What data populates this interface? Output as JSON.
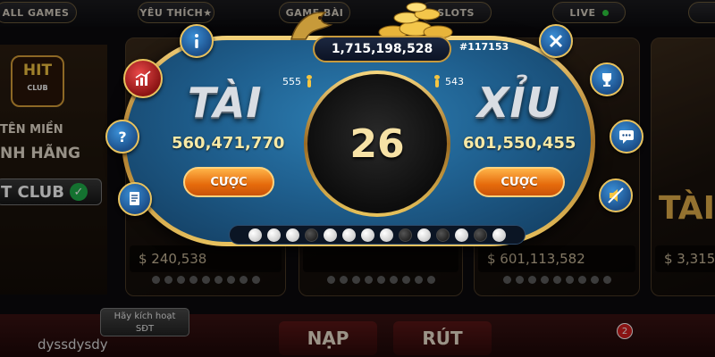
{
  "topnav": {
    "all_games": "ALL GAMES",
    "favorites": "YÊU THÍCH★",
    "card_games": "GAME BÀI",
    "slots": "SLOTS",
    "live": "LIVE"
  },
  "left_panel": {
    "logo_text": "HIT",
    "logo_sub": "CLUB",
    "promo_line1": "TÊN MIỀN",
    "promo_line2": "NH HÃNG",
    "club_label": "T CLUB"
  },
  "bg_cards": {
    "jackpots": [
      "$ 240,538",
      "",
      "$ 601,113,582",
      "$ 3,315"
    ],
    "side_text": "TÀI"
  },
  "bottom": {
    "activate_line1": "Hãy kích hoạt",
    "activate_line2": "SĐT",
    "username": "dyssdysdy",
    "deposit": "NẠP",
    "withdraw": "RÚT",
    "notification_count": "2"
  },
  "game": {
    "total_pot": "1,715,198,528",
    "session_id": "#117153",
    "tai": {
      "title": "TÀI",
      "players": "555",
      "pool": "560,471,770",
      "bet_label": "CƯỢC"
    },
    "xiu": {
      "title": "XỈU",
      "players": "543",
      "pool": "601,550,455",
      "bet_label": "CƯỢC"
    },
    "dice_total": "26",
    "history": [
      "white",
      "white",
      "white",
      "black",
      "white",
      "white",
      "white",
      "white",
      "black",
      "white",
      "black",
      "white",
      "black",
      "white"
    ]
  },
  "icons": {
    "left": [
      "info-icon",
      "chart-icon",
      "help-icon",
      "rules-icon"
    ],
    "right": [
      "close-icon",
      "trophy-icon",
      "chat-icon",
      "sound-off-icon"
    ]
  },
  "colors": {
    "board_blue": "#1f5f8e",
    "gold_trim": "#e8c25e",
    "bet_orange": "#e56a0b",
    "pool_yellow": "#f7e9a6"
  }
}
